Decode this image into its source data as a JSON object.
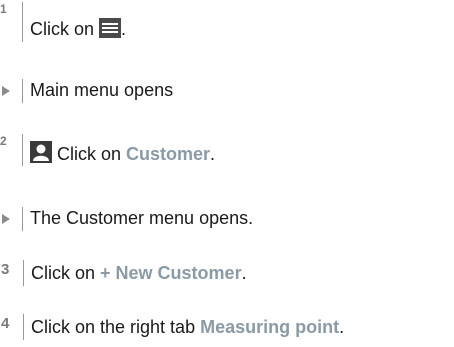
{
  "steps": [
    {
      "marker": "1",
      "prefix": "Click on ",
      "icon": "hamburger-menu-icon",
      "suffix": "."
    },
    {
      "marker": "result",
      "text": "Main menu opens"
    },
    {
      "marker": "2",
      "icon": "user-icon",
      "prefix": " Click on ",
      "highlight": "Customer",
      "suffix": "."
    },
    {
      "marker": "result",
      "text": "The Customer menu opens."
    },
    {
      "marker": "3",
      "prefix": "Click on ",
      "highlight": "+ New Customer",
      "suffix": "."
    },
    {
      "marker": "4",
      "prefix": "Click on the right tab ",
      "highlight": "Measuring point",
      "suffix": "."
    }
  ],
  "colors": {
    "highlight": "#8a9aa6",
    "marker": "#7a7a7a",
    "text": "#1a1a1a",
    "bar": "#9a9a9a"
  }
}
